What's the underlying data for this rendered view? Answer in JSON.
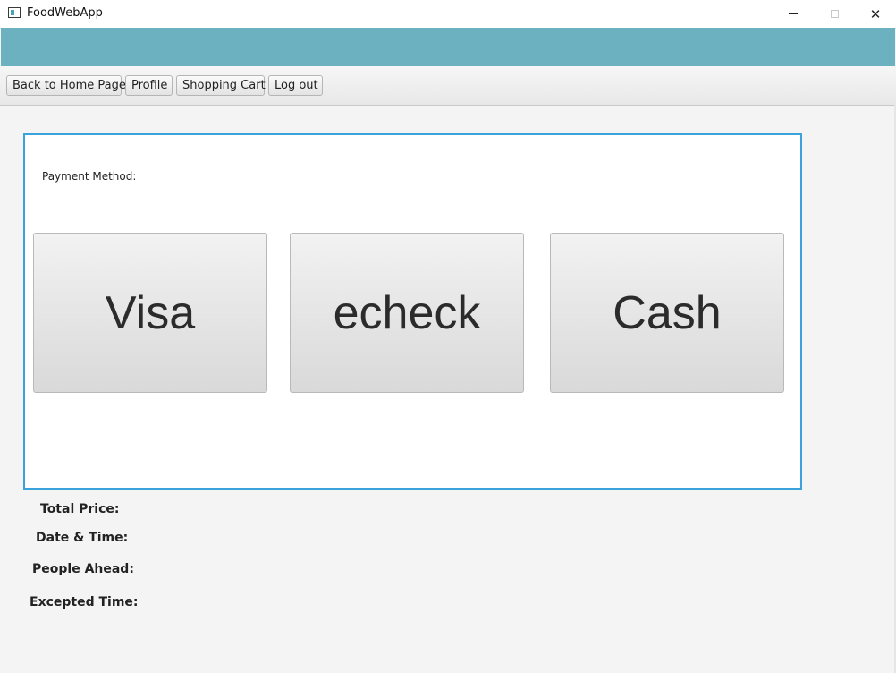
{
  "window": {
    "title": "FoodWebApp",
    "controls": [
      "minimize",
      "maximize",
      "close"
    ]
  },
  "toolbar": {
    "home_label": "Back to Home Page",
    "profile_label": "Profile",
    "cart_label": "Shopping Cart",
    "logout_label": "Log out"
  },
  "payment": {
    "label": "Payment Method:",
    "options": [
      "Visa",
      "echeck",
      "Cash"
    ]
  },
  "info": {
    "total_price": "Total Price:",
    "date_time": "Date & Time:",
    "people_ahead": "People Ahead:",
    "excepted_time": "Excepted Time:"
  },
  "colors": {
    "banner": "#6cb1c0",
    "panel_border": "#3aa3dc"
  }
}
